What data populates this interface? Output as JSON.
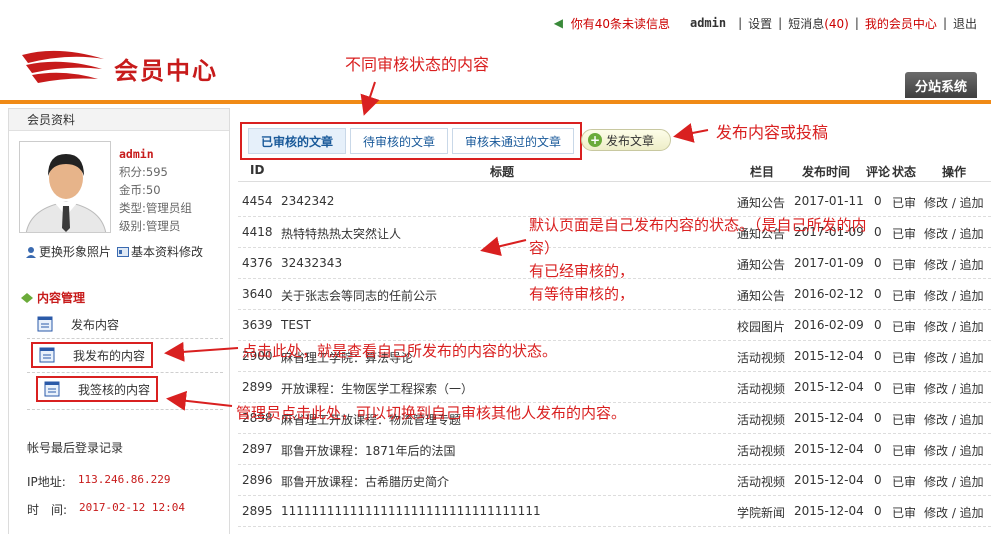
{
  "topbar": {
    "unread": "你有40条未读信息",
    "username": "admin",
    "settings": "设置",
    "sms": "短消息",
    "sms_count": "(40)",
    "member_center": "我的会员中心",
    "logout": "退出"
  },
  "header": {
    "title": "会员中心",
    "subsite_button": "分站系统"
  },
  "sidebar": {
    "title": "会员资料",
    "profile": {
      "name": "admin",
      "points": "积分:595",
      "gold": "金币:50",
      "type": "类型:管理员组",
      "level": "级别:管理员"
    },
    "change_photo": "更换形象照片",
    "edit_profile": "基本资料修改",
    "content_section": "内容管理",
    "nav": [
      "发布内容",
      "我发布的内容",
      "我签核的内容"
    ],
    "login_title": "帐号最后登录记录",
    "ip_label": "IP地址:",
    "ip": "113.246.86.229",
    "time_label": "时　间:",
    "time": "2017-02-12 12:04"
  },
  "tabs": [
    "已审核的文章",
    "待审核的文章",
    "审核未通过的文章"
  ],
  "publish_button": "发布文章",
  "table": {
    "headers": {
      "id": "ID",
      "title": "标题",
      "column": "栏目",
      "time": "发布时间",
      "comments": "评论",
      "status": "状态",
      "ops": "操作"
    },
    "rows": [
      {
        "id": "4454",
        "title": "2342342",
        "column": "通知公告",
        "time": "2017-01-11",
        "comments": "0",
        "status": "已审",
        "ops": "修改 / 追加"
      },
      {
        "id": "4418",
        "title": "热特特热热太突然让人",
        "column": "通知公告",
        "time": "2017-01-09",
        "comments": "0",
        "status": "已审",
        "ops": "修改 / 追加"
      },
      {
        "id": "4376",
        "title": "32432343",
        "column": "通知公告",
        "time": "2017-01-09",
        "comments": "0",
        "status": "已审",
        "ops": "修改 / 追加"
      },
      {
        "id": "3640",
        "title": "关于张志会等同志的任前公示",
        "column": "通知公告",
        "time": "2016-02-12",
        "comments": "0",
        "status": "已审",
        "ops": "修改 / 追加"
      },
      {
        "id": "3639",
        "title": "TEST",
        "column": "校园图片",
        "time": "2016-02-09",
        "comments": "0",
        "status": "已审",
        "ops": "修改 / 追加"
      },
      {
        "id": "2900",
        "title": "麻省理工学院：算法导论",
        "column": "活动视频",
        "time": "2015-12-04",
        "comments": "0",
        "status": "已审",
        "ops": "修改 / 追加"
      },
      {
        "id": "2899",
        "title": "开放课程：生物医学工程探索（一）",
        "column": "活动视频",
        "time": "2015-12-04",
        "comments": "0",
        "status": "已审",
        "ops": "修改 / 追加"
      },
      {
        "id": "2898",
        "title": "麻省理工开放课程：物流管理专题",
        "column": "活动视频",
        "time": "2015-12-04",
        "comments": "0",
        "status": "已审",
        "ops": "修改 / 追加"
      },
      {
        "id": "2897",
        "title": "耶鲁开放课程：1871年后的法国",
        "column": "活动视频",
        "time": "2015-12-04",
        "comments": "0",
        "status": "已审",
        "ops": "修改 / 追加"
      },
      {
        "id": "2896",
        "title": "耶鲁开放课程：古希腊历史简介",
        "column": "活动视频",
        "time": "2015-12-04",
        "comments": "0",
        "status": "已审",
        "ops": "修改 / 追加"
      },
      {
        "id": "2895",
        "title": "1111111111111111111111111111111111",
        "column": "学院新闻",
        "time": "2015-12-04",
        "comments": "0",
        "status": "已审",
        "ops": "修改 / 追加"
      }
    ]
  },
  "annotations": {
    "tabs_note": "不同审核状态的内容",
    "publish_note": "发布内容或投稿",
    "default_line1": "默认页面是自己发布内容的状态。（是自己所发的内",
    "default_line2": "容）",
    "default_line3": "有已经审核的，",
    "default_line4": "有等待审核的，",
    "my_posts_note": "点击此处，就是查看自己所发布的内容的状态。",
    "admin_note": "管理员点击此处，可以切换到自己审核其他人发布的内容。"
  },
  "colors": {
    "accent_red": "#d92020",
    "orange": "#f08a16",
    "link_blue": "#1a5a9a"
  }
}
